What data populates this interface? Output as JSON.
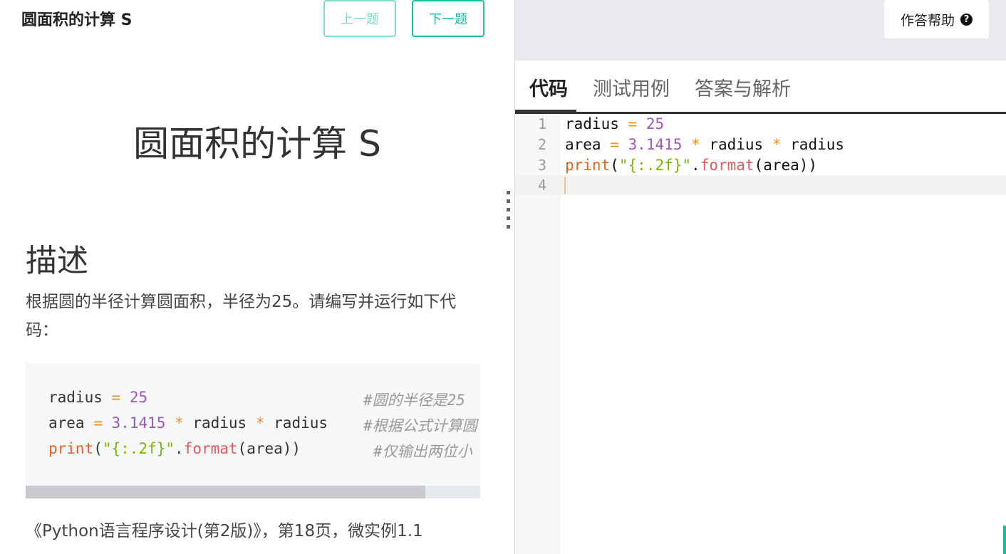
{
  "header": {
    "title": "圆面积的计算 S",
    "prev_label": "上一题",
    "next_label": "下一题"
  },
  "problem": {
    "heading": "圆面积的计算 S",
    "description_heading": "描述",
    "description": "根据圆的半径计算圆面积，半径为25。请编写并运行如下代码：",
    "reference": "《Python语言程序设计(第2版)》，第18页，微实例1.1"
  },
  "sample_code": {
    "lines": [
      {
        "code": "radius = 25",
        "comment": "#圆的半径是25"
      },
      {
        "code": "area = 3.1415 * radius * radius",
        "comment": "#根据公式计算圆"
      },
      {
        "code": "print(\"{:.2f}\".format(area))",
        "comment": "#仅输出两位小"
      }
    ],
    "scroll_fraction": 0.88
  },
  "right_panel": {
    "help_label": "作答帮助",
    "help_icon": "question-circle-icon",
    "tabs": [
      {
        "label": "代码",
        "active": true
      },
      {
        "label": "测试用例",
        "active": false
      },
      {
        "label": "答案与解析",
        "active": false
      }
    ]
  },
  "editor": {
    "line_numbers": [
      "1",
      "2",
      "3",
      "4"
    ],
    "lines": [
      "radius = 25",
      "area = 3.1415 * radius * radius",
      "print(\"{:.2f}\".format(area))",
      ""
    ],
    "active_line": 4
  },
  "colors": {
    "accent": "#1abc9c",
    "operator": "#f0901c",
    "number": "#9b59b6",
    "keyword": "#e8621a",
    "string": "#7ab800"
  }
}
